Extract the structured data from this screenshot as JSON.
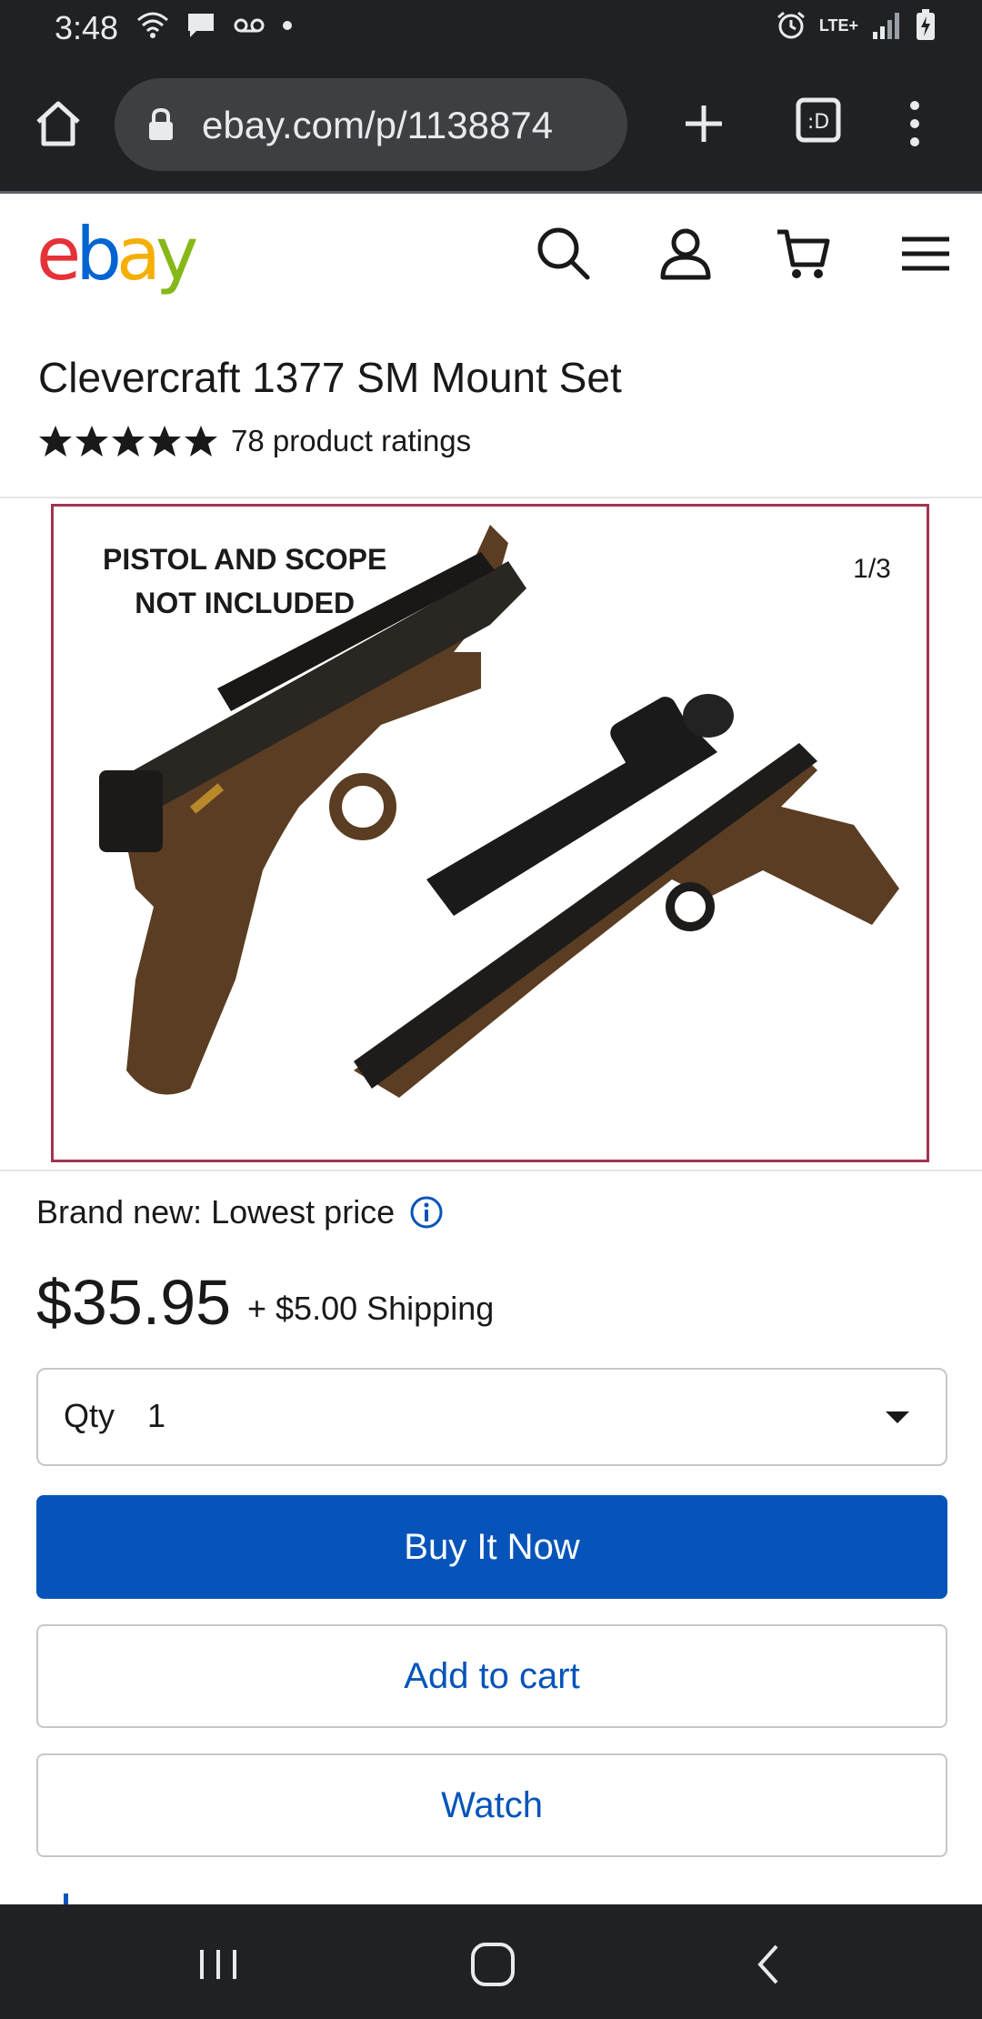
{
  "status_bar": {
    "time": "3:48",
    "network": "LTE+"
  },
  "browser": {
    "url": "ebay.com/p/1138874"
  },
  "ebay_header": {
    "logo_letters": [
      "e",
      "b",
      "a",
      "y"
    ],
    "logo_colors": [
      "#e53238",
      "#0064d2",
      "#f5af02",
      "#86b817"
    ]
  },
  "product": {
    "title": "Clevercraft 1377 SM Mount Set",
    "rating_stars": 5,
    "ratings_text": "78 product ratings",
    "image_caption_line1": "PISTOL AND SCOPE",
    "image_caption_line2": "NOT INCLUDED",
    "image_counter": "1/3"
  },
  "pricing": {
    "condition": "Brand new: Lowest price",
    "price": "$35.95",
    "shipping": "+ $5.00 Shipping",
    "qty_label": "Qty",
    "qty_value": "1"
  },
  "actions": {
    "buy_now": "Buy It Now",
    "add_to_cart": "Add to cart",
    "watch": "Watch"
  },
  "colors": {
    "primary_blue": "#0654ba",
    "dark_chrome": "#202124",
    "image_border": "#a13550"
  }
}
